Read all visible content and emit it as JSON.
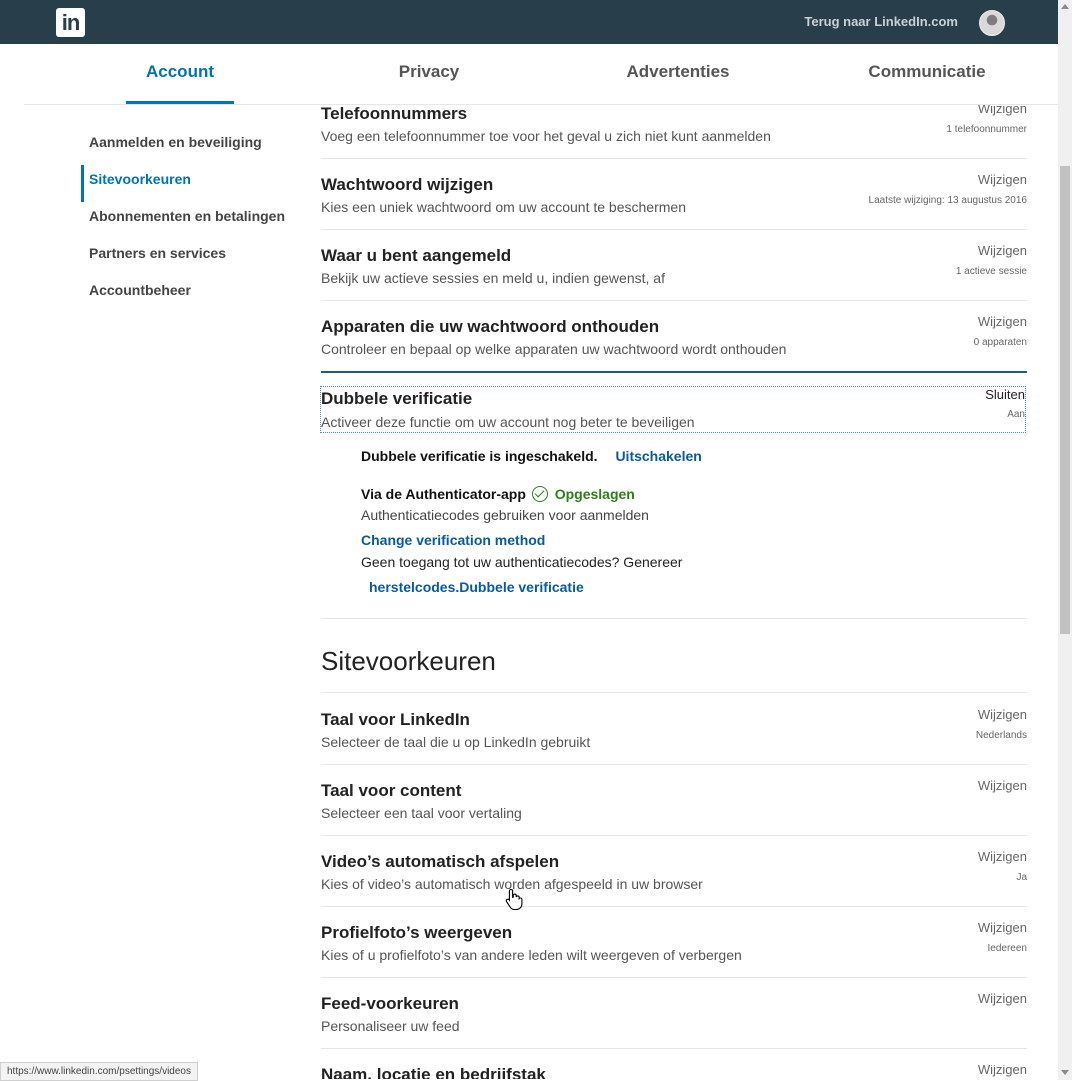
{
  "header": {
    "logo_text": "in",
    "back_link": "Terug naar LinkedIn.com"
  },
  "tabs": [
    {
      "label": "Account",
      "active": true
    },
    {
      "label": "Privacy",
      "active": false
    },
    {
      "label": "Advertenties",
      "active": false
    },
    {
      "label": "Communicatie",
      "active": false
    }
  ],
  "sidebar": {
    "items": [
      {
        "label": "Aanmelden en beveiliging",
        "active": false
      },
      {
        "label": "Sitevoorkeuren",
        "active": true
      },
      {
        "label": "Abonnementen en betalingen",
        "active": false
      },
      {
        "label": "Partners en services",
        "active": false
      },
      {
        "label": "Accountbeheer",
        "active": false
      }
    ]
  },
  "security_rows": [
    {
      "title": "Telefoonnummers",
      "desc": "Voeg een telefoonnummer toe voor het geval u zich niet kunt aanmelden",
      "action": "Wijzigen",
      "value": "1 telefoonnummer"
    },
    {
      "title": "Wachtwoord wijzigen",
      "desc": "Kies een uniek wachtwoord om uw account te beschermen",
      "action": "Wijzigen",
      "value": "Laatste wijziging: 13 augustus 2016"
    },
    {
      "title": "Waar u bent aangemeld",
      "desc": "Bekijk uw actieve sessies en meld u, indien gewenst, af",
      "action": "Wijzigen",
      "value": "1 actieve sessie"
    },
    {
      "title": "Apparaten die uw wachtwoord onthouden",
      "desc": "Controleer en bepaal op welke apparaten uw wachtwoord wordt onthouden",
      "action": "Wijzigen",
      "value": "0 apparaten"
    }
  ],
  "two_factor": {
    "title": "Dubbele verificatie",
    "desc": "Activeer deze functie om uw account nog beter te beveiligen",
    "action": "Sluiten",
    "value": "Aan",
    "status_text": "Dubbele verificatie is ingeschakeld.",
    "disable_link": "Uitschakelen",
    "method_label": "Via de Authenticator-app",
    "saved_label": "Opgeslagen",
    "method_desc": "Authenticatiecodes gebruiken voor aanmelden",
    "change_link": "Change verification method",
    "no_access_text": "Geen toegang tot uw authenticatiecodes? Genereer",
    "recovery_link": "herstelcodes.Dubbele verificatie"
  },
  "site_section": {
    "title": "Sitevoorkeuren",
    "rows": [
      {
        "title": "Taal voor LinkedIn",
        "desc": "Selecteer de taal die u op LinkedIn gebruikt",
        "action": "Wijzigen",
        "value": "Nederlands"
      },
      {
        "title": "Taal voor content",
        "desc": "Selecteer een taal voor vertaling",
        "action": "Wijzigen",
        "value": ""
      },
      {
        "title": "Video’s automatisch afspelen",
        "desc": "Kies of video’s automatisch worden afgespeeld in uw browser",
        "action": "Wijzigen",
        "value": "Ja"
      },
      {
        "title": "Profielfoto’s weergeven",
        "desc": "Kies of u profielfoto’s van andere leden wilt weergeven of verbergen",
        "action": "Wijzigen",
        "value": "Iedereen"
      },
      {
        "title": "Feed-voorkeuren",
        "desc": "Personaliseer uw feed",
        "action": "Wijzigen",
        "value": ""
      },
      {
        "title": "Naam, locatie en bedrijfstak",
        "desc": "",
        "action": "Wijzigen",
        "value": ""
      }
    ]
  },
  "statusbar": {
    "url": "https://www.linkedin.com/psettings/videos"
  },
  "colors": {
    "brand": "#0073b1",
    "topbar": "#283e4a",
    "success": "#2e7d1a"
  }
}
